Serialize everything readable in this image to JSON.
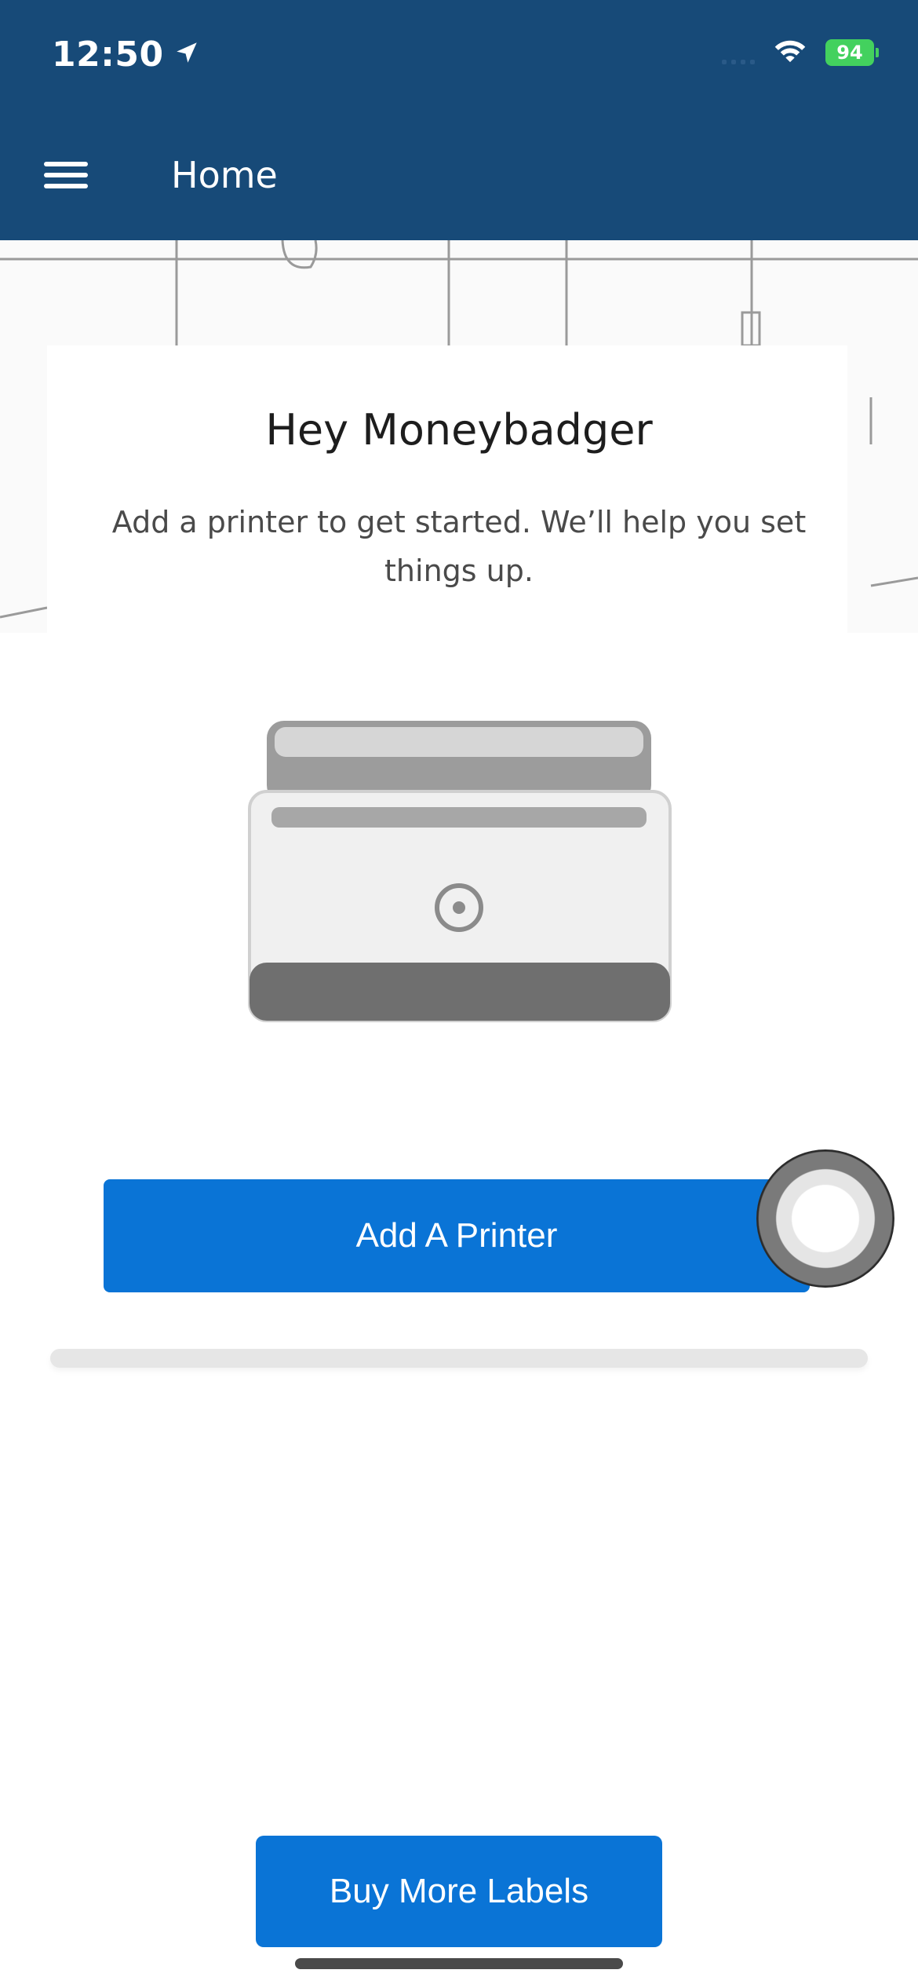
{
  "status_bar": {
    "time": "12:50",
    "battery": "94"
  },
  "header": {
    "title": "Home"
  },
  "welcome": {
    "greeting": "Hey Moneybadger",
    "subtext": "Add a printer to get started. We’ll help you set things up."
  },
  "actions": {
    "add_printer_label": "Add A Printer",
    "buy_labels_label": "Buy More Labels"
  },
  "colors": {
    "header_bg": "#174a78",
    "primary_button": "#0a74d6"
  },
  "icons": {
    "menu": "hamburger-menu-icon",
    "location": "location-arrow-icon",
    "wifi": "wifi-icon",
    "battery": "battery-icon",
    "printer": "printer-illustration"
  }
}
